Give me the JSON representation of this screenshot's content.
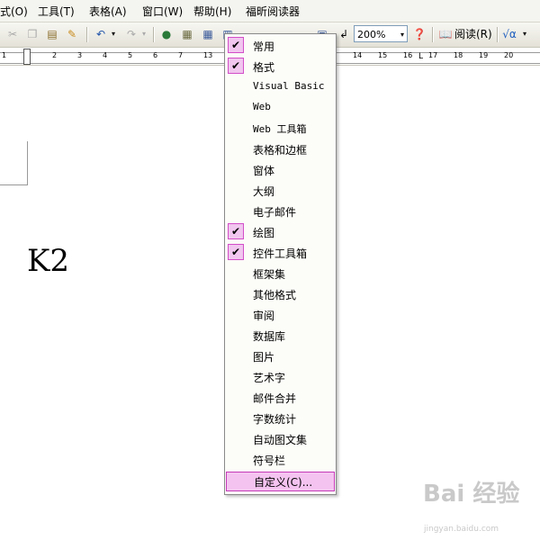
{
  "menubar": {
    "items": [
      "式(O)",
      "工具(T)",
      "表格(A)",
      "窗口(W)",
      "帮助(H)",
      "福昕阅读器"
    ]
  },
  "toolbar": {
    "zoom": "200%",
    "read_label": "阅读(R)",
    "formula_label": "√α"
  },
  "ruler": {
    "numbers": [
      "1",
      "2",
      "3",
      "4",
      "5",
      "6",
      "7",
      "13",
      "14",
      "15",
      "16",
      "17",
      "18",
      "19",
      "20"
    ]
  },
  "document": {
    "text": "K2"
  },
  "toolbars_menu": {
    "items": [
      {
        "label": "常用",
        "checked": true
      },
      {
        "label": "格式",
        "checked": true
      },
      {
        "label": "Visual Basic",
        "checked": false
      },
      {
        "label": "Web",
        "checked": false
      },
      {
        "label": "Web 工具箱",
        "checked": false
      },
      {
        "label": "表格和边框",
        "checked": false
      },
      {
        "label": "窗体",
        "checked": false
      },
      {
        "label": "大纲",
        "checked": false
      },
      {
        "label": "电子邮件",
        "checked": false
      },
      {
        "label": "绘图",
        "checked": true
      },
      {
        "label": "控件工具箱",
        "checked": true
      },
      {
        "label": "框架集",
        "checked": false
      },
      {
        "label": "其他格式",
        "checked": false
      },
      {
        "label": "审阅",
        "checked": false
      },
      {
        "label": "数据库",
        "checked": false
      },
      {
        "label": "图片",
        "checked": false
      },
      {
        "label": "艺术字",
        "checked": false
      },
      {
        "label": "邮件合并",
        "checked": false
      },
      {
        "label": "字数统计",
        "checked": false
      },
      {
        "label": "自动图文集",
        "checked": false
      },
      {
        "label": "符号栏",
        "checked": false
      },
      {
        "label": "自定义(C)...",
        "checked": false
      }
    ]
  },
  "watermark": {
    "text": "Bai 经验",
    "url": "jingyan.baidu.com"
  }
}
